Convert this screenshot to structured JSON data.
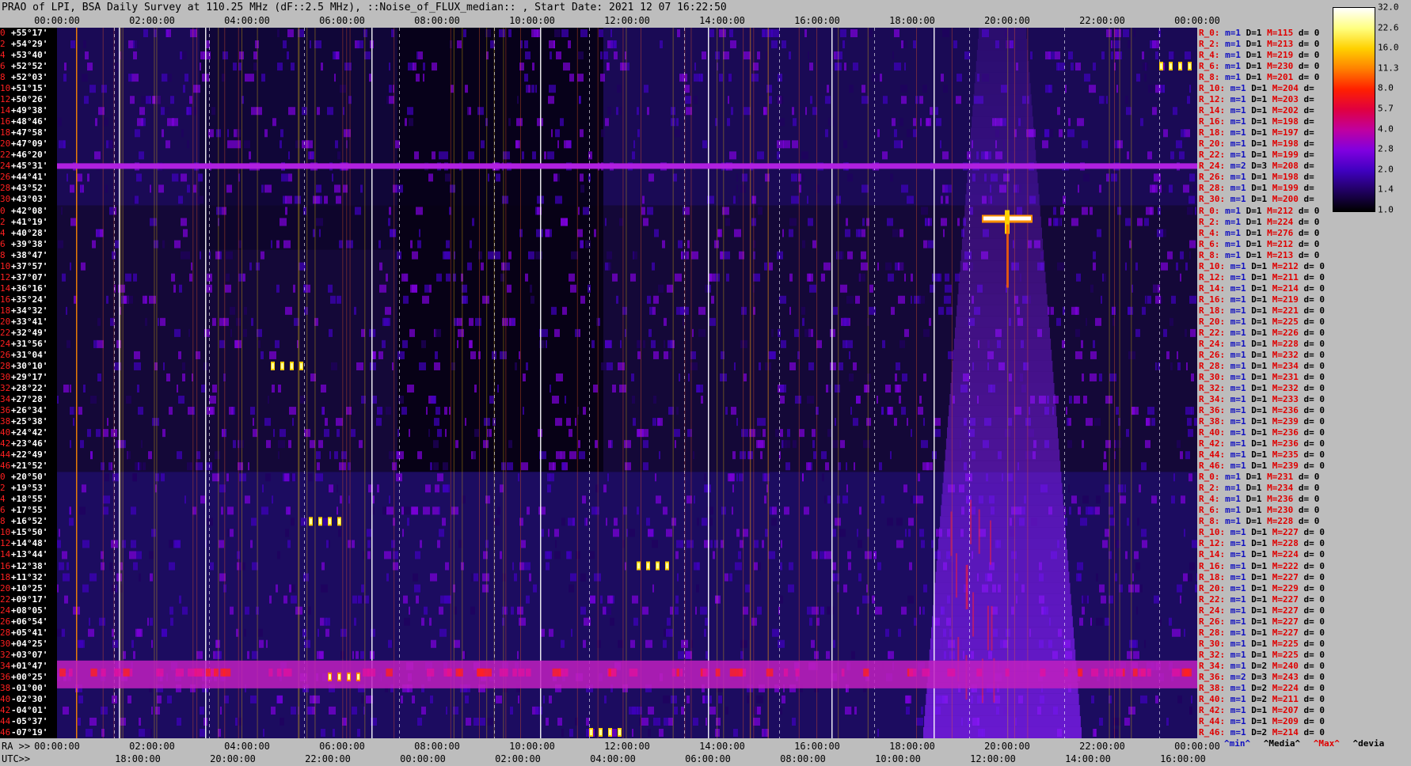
{
  "title": "PRAO of LPI, BSA Daily Survey at 110.25 MHz (dF::2.5 MHz), ::Noise_of_FLUX_median:: , Start Date: 2021 12 07 16:22:50",
  "top_axis": [
    "00:00:00",
    "02:00:00",
    "04:00:00",
    "06:00:00",
    "08:00:00",
    "10:00:00",
    "12:00:00",
    "14:00:00",
    "16:00:00",
    "18:00:00",
    "20:00:00",
    "22:00:00",
    "00:00:00"
  ],
  "ra_prefix": "RA >>",
  "ra_axis": [
    "00:00:00",
    "02:00:00",
    "04:00:00",
    "06:00:00",
    "08:00:00",
    "10:00:00",
    "12:00:00",
    "14:00:00",
    "16:00:00",
    "18:00:00",
    "20:00:00",
    "22:00:00",
    "00:00:00"
  ],
  "utc_prefix": "UTC>>",
  "utc_axis": [
    "18:00:00",
    "20:00:00",
    "22:00:00",
    "00:00:00",
    "02:00:00",
    "04:00:00",
    "06:00:00",
    "08:00:00",
    "10:00:00",
    "12:00:00",
    "14:00:00",
    "16:00:00"
  ],
  "declinations": [
    {
      "i": "0",
      "dec": "+55°17'"
    },
    {
      "i": "2",
      "dec": "+54°29'"
    },
    {
      "i": "4",
      "dec": "+53°40'"
    },
    {
      "i": "6",
      "dec": "+52°52'"
    },
    {
      "i": "8",
      "dec": "+52°03'"
    },
    {
      "i": "10",
      "dec": "+51°15'"
    },
    {
      "i": "12",
      "dec": "+50°26'"
    },
    {
      "i": "14",
      "dec": "+49°38'"
    },
    {
      "i": "16",
      "dec": "+48°46'"
    },
    {
      "i": "18",
      "dec": "+47°58'"
    },
    {
      "i": "20",
      "dec": "+47°09'"
    },
    {
      "i": "22",
      "dec": "+46°20'"
    },
    {
      "i": "24",
      "dec": "+45°31'"
    },
    {
      "i": "26",
      "dec": "+44°41'"
    },
    {
      "i": "28",
      "dec": "+43°52'"
    },
    {
      "i": "30",
      "dec": "+43°03'"
    },
    {
      "i": "0",
      "dec": "+42°08'"
    },
    {
      "i": "2",
      "dec": "+41°19'"
    },
    {
      "i": "4",
      "dec": "+40°28'"
    },
    {
      "i": "6",
      "dec": "+39°38'"
    },
    {
      "i": "8",
      "dec": "+38°47'"
    },
    {
      "i": "10",
      "dec": "+37°57'"
    },
    {
      "i": "12",
      "dec": "+37°07'"
    },
    {
      "i": "14",
      "dec": "+36°16'"
    },
    {
      "i": "16",
      "dec": "+35°24'"
    },
    {
      "i": "18",
      "dec": "+34°32'"
    },
    {
      "i": "20",
      "dec": "+33°41'"
    },
    {
      "i": "22",
      "dec": "+32°49'"
    },
    {
      "i": "24",
      "dec": "+31°56'"
    },
    {
      "i": "26",
      "dec": "+31°04'"
    },
    {
      "i": "28",
      "dec": "+30°10'"
    },
    {
      "i": "30",
      "dec": "+29°17'"
    },
    {
      "i": "32",
      "dec": "+28°22'"
    },
    {
      "i": "34",
      "dec": "+27°28'"
    },
    {
      "i": "36",
      "dec": "+26°34'"
    },
    {
      "i": "38",
      "dec": "+25°38'"
    },
    {
      "i": "40",
      "dec": "+24°42'"
    },
    {
      "i": "42",
      "dec": "+23°46'"
    },
    {
      "i": "44",
      "dec": "+22°49'"
    },
    {
      "i": "46",
      "dec": "+21°52'"
    },
    {
      "i": "0",
      "dec": "+20°50'"
    },
    {
      "i": "2",
      "dec": "+19°53'"
    },
    {
      "i": "4",
      "dec": "+18°55'"
    },
    {
      "i": "6",
      "dec": "+17°55'"
    },
    {
      "i": "8",
      "dec": "+16°52'"
    },
    {
      "i": "10",
      "dec": "+15°50'"
    },
    {
      "i": "12",
      "dec": "+14°48'"
    },
    {
      "i": "14",
      "dec": "+13°44'"
    },
    {
      "i": "16",
      "dec": "+12°38'"
    },
    {
      "i": "18",
      "dec": "+11°32'"
    },
    {
      "i": "20",
      "dec": "+10°25'"
    },
    {
      "i": "22",
      "dec": "+09°17'"
    },
    {
      "i": "24",
      "dec": "+08°05'"
    },
    {
      "i": "26",
      "dec": "+06°54'"
    },
    {
      "i": "28",
      "dec": "+05°41'"
    },
    {
      "i": "30",
      "dec": "+04°25'"
    },
    {
      "i": "32",
      "dec": "+03°07'"
    },
    {
      "i": "34",
      "dec": "+01°47'"
    },
    {
      "i": "36",
      "dec": "+00°25'"
    },
    {
      "i": "38",
      "dec": "-01°00'"
    },
    {
      "i": "40",
      "dec": "-02°30'"
    },
    {
      "i": "42",
      "dec": "-04°01'"
    },
    {
      "i": "44",
      "dec": "-05°37'"
    },
    {
      "i": "46",
      "dec": "-07°19'"
    }
  ],
  "stats": [
    {
      "r": "R_0:",
      "m": "m=1",
      "D": "D=1",
      "M": "M=115",
      "d": "d= 0"
    },
    {
      "r": "R_2:",
      "m": "m=1",
      "D": "D=1",
      "M": "M=213",
      "d": "d= 0"
    },
    {
      "r": "R_4:",
      "m": "m=1",
      "D": "D=1",
      "M": "M=219",
      "d": "d= 0"
    },
    {
      "r": "R_6:",
      "m": "m=1",
      "D": "D=1",
      "M": "M=230",
      "d": "d= 0"
    },
    {
      "r": "R_8:",
      "m": "m=1",
      "D": "D=1",
      "M": "M=201",
      "d": "d= 0"
    },
    {
      "r": "R_10:",
      "m": "m=1",
      "D": "D=1",
      "M": "M=204",
      "d": "d="
    },
    {
      "r": "R_12:",
      "m": "m=1",
      "D": "D=1",
      "M": "M=203",
      "d": "d="
    },
    {
      "r": "R_14:",
      "m": "m=1",
      "D": "D=1",
      "M": "M=202",
      "d": "d="
    },
    {
      "r": "R_16:",
      "m": "m=1",
      "D": "D=1",
      "M": "M=198",
      "d": "d="
    },
    {
      "r": "R_18:",
      "m": "m=1",
      "D": "D=1",
      "M": "M=197",
      "d": "d="
    },
    {
      "r": "R_20:",
      "m": "m=1",
      "D": "D=1",
      "M": "M=198",
      "d": "d="
    },
    {
      "r": "R_22:",
      "m": "m=1",
      "D": "D=1",
      "M": "M=199",
      "d": "d="
    },
    {
      "r": "R_24:",
      "m": "m=2",
      "D": "D=3",
      "M": "M=208",
      "d": "d="
    },
    {
      "r": "R_26:",
      "m": "m=1",
      "D": "D=1",
      "M": "M=198",
      "d": "d="
    },
    {
      "r": "R_28:",
      "m": "m=1",
      "D": "D=1",
      "M": "M=199",
      "d": "d="
    },
    {
      "r": "R_30:",
      "m": "m=1",
      "D": "D=1",
      "M": "M=200",
      "d": "d="
    },
    {
      "r": "R_0:",
      "m": "m=1",
      "D": "D=1",
      "M": "M=212",
      "d": "d= 0"
    },
    {
      "r": "R_2:",
      "m": "m=1",
      "D": "D=1",
      "M": "M=224",
      "d": "d= 0"
    },
    {
      "r": "R_4:",
      "m": "m=1",
      "D": "D=1",
      "M": "M=276",
      "d": "d= 0"
    },
    {
      "r": "R_6:",
      "m": "m=1",
      "D": "D=1",
      "M": "M=212",
      "d": "d= 0"
    },
    {
      "r": "R_8:",
      "m": "m=1",
      "D": "D=1",
      "M": "M=213",
      "d": "d= 0"
    },
    {
      "r": "R_10:",
      "m": "m=1",
      "D": "D=1",
      "M": "M=212",
      "d": "d= 0"
    },
    {
      "r": "R_12:",
      "m": "m=1",
      "D": "D=1",
      "M": "M=211",
      "d": "d= 0"
    },
    {
      "r": "R_14:",
      "m": "m=1",
      "D": "D=1",
      "M": "M=214",
      "d": "d= 0"
    },
    {
      "r": "R_16:",
      "m": "m=1",
      "D": "D=1",
      "M": "M=219",
      "d": "d= 0"
    },
    {
      "r": "R_18:",
      "m": "m=1",
      "D": "D=1",
      "M": "M=221",
      "d": "d= 0"
    },
    {
      "r": "R_20:",
      "m": "m=1",
      "D": "D=1",
      "M": "M=225",
      "d": "d= 0"
    },
    {
      "r": "R_22:",
      "m": "m=1",
      "D": "D=1",
      "M": "M=226",
      "d": "d= 0"
    },
    {
      "r": "R_24:",
      "m": "m=1",
      "D": "D=1",
      "M": "M=228",
      "d": "d= 0"
    },
    {
      "r": "R_26:",
      "m": "m=1",
      "D": "D=1",
      "M": "M=232",
      "d": "d= 0"
    },
    {
      "r": "R_28:",
      "m": "m=1",
      "D": "D=1",
      "M": "M=234",
      "d": "d= 0"
    },
    {
      "r": "R_30:",
      "m": "m=1",
      "D": "D=1",
      "M": "M=231",
      "d": "d= 0"
    },
    {
      "r": "R_32:",
      "m": "m=1",
      "D": "D=1",
      "M": "M=232",
      "d": "d= 0"
    },
    {
      "r": "R_34:",
      "m": "m=1",
      "D": "D=1",
      "M": "M=233",
      "d": "d= 0"
    },
    {
      "r": "R_36:",
      "m": "m=1",
      "D": "D=1",
      "M": "M=236",
      "d": "d= 0"
    },
    {
      "r": "R_38:",
      "m": "m=1",
      "D": "D=1",
      "M": "M=239",
      "d": "d= 0"
    },
    {
      "r": "R_40:",
      "m": "m=1",
      "D": "D=1",
      "M": "M=236",
      "d": "d= 0"
    },
    {
      "r": "R_42:",
      "m": "m=1",
      "D": "D=1",
      "M": "M=236",
      "d": "d= 0"
    },
    {
      "r": "R_44:",
      "m": "m=1",
      "D": "D=1",
      "M": "M=235",
      "d": "d= 0"
    },
    {
      "r": "R_46:",
      "m": "m=1",
      "D": "D=1",
      "M": "M=239",
      "d": "d= 0"
    },
    {
      "r": "R_0:",
      "m": "m=1",
      "D": "D=1",
      "M": "M=231",
      "d": "d= 0"
    },
    {
      "r": "R_2:",
      "m": "m=1",
      "D": "D=1",
      "M": "M=234",
      "d": "d= 0"
    },
    {
      "r": "R_4:",
      "m": "m=1",
      "D": "D=1",
      "M": "M=236",
      "d": "d= 0"
    },
    {
      "r": "R_6:",
      "m": "m=1",
      "D": "D=1",
      "M": "M=230",
      "d": "d= 0"
    },
    {
      "r": "R_8:",
      "m": "m=1",
      "D": "D=1",
      "M": "M=228",
      "d": "d= 0"
    },
    {
      "r": "R_10:",
      "m": "m=1",
      "D": "D=1",
      "M": "M=227",
      "d": "d= 0"
    },
    {
      "r": "R_12:",
      "m": "m=1",
      "D": "D=1",
      "M": "M=228",
      "d": "d= 0"
    },
    {
      "r": "R_14:",
      "m": "m=1",
      "D": "D=1",
      "M": "M=224",
      "d": "d= 0"
    },
    {
      "r": "R_16:",
      "m": "m=1",
      "D": "D=1",
      "M": "M=222",
      "d": "d= 0"
    },
    {
      "r": "R_18:",
      "m": "m=1",
      "D": "D=1",
      "M": "M=227",
      "d": "d= 0"
    },
    {
      "r": "R_20:",
      "m": "m=1",
      "D": "D=1",
      "M": "M=229",
      "d": "d= 0"
    },
    {
      "r": "R_22:",
      "m": "m=1",
      "D": "D=1",
      "M": "M=227",
      "d": "d= 0"
    },
    {
      "r": "R_24:",
      "m": "m=1",
      "D": "D=1",
      "M": "M=227",
      "d": "d= 0"
    },
    {
      "r": "R_26:",
      "m": "m=1",
      "D": "D=1",
      "M": "M=227",
      "d": "d= 0"
    },
    {
      "r": "R_28:",
      "m": "m=1",
      "D": "D=1",
      "M": "M=227",
      "d": "d= 0"
    },
    {
      "r": "R_30:",
      "m": "m=1",
      "D": "D=1",
      "M": "M=225",
      "d": "d= 0"
    },
    {
      "r": "R_32:",
      "m": "m=1",
      "D": "D=1",
      "M": "M=225",
      "d": "d= 0"
    },
    {
      "r": "R_34:",
      "m": "m=1",
      "D": "D=2",
      "M": "M=240",
      "d": "d= 0"
    },
    {
      "r": "R_36:",
      "m": "m=2",
      "D": "D=3",
      "M": "M=243",
      "d": "d= 0"
    },
    {
      "r": "R_38:",
      "m": "m=1",
      "D": "D=2",
      "M": "M=224",
      "d": "d= 0"
    },
    {
      "r": "R_40:",
      "m": "m=1",
      "D": "D=2",
      "M": "M=211",
      "d": "d= 0"
    },
    {
      "r": "R_42:",
      "m": "m=1",
      "D": "D=1",
      "M": "M=207",
      "d": "d= 0"
    },
    {
      "r": "R_44:",
      "m": "m=1",
      "D": "D=1",
      "M": "M=209",
      "d": "d= 0"
    },
    {
      "r": "R_46:",
      "m": "m=1",
      "D": "D=2",
      "M": "M=214",
      "d": "d= 0"
    }
  ],
  "colorbar": {
    "labels": [
      "32.0",
      "22.6",
      "16.0",
      "11.3",
      "8.0",
      "5.7",
      "4.0",
      "2.8",
      "2.0",
      "1.4",
      "1.0"
    ],
    "colors": [
      "#ffffff",
      "#ffff80",
      "#ffd000",
      "#ff8000",
      "#ff2000",
      "#e00040",
      "#c000a0",
      "#8000e0",
      "#4000c0",
      "#200060",
      "#000000"
    ]
  },
  "legend": {
    "min": "^min^",
    "median": "^Media^",
    "max": "^Max^",
    "devia": "^devia"
  },
  "chart_data": {
    "type": "heatmap",
    "title": "PRAO of LPI, BSA Daily Survey at 110.25 MHz (dF::2.5 MHz), ::Noise_of_FLUX_median:: , Start Date: 2021 12 07 16:22:50",
    "xlabel": "RA / UTC",
    "ylabel": "",
    "x_range": [
      "00:00:00",
      "00:00:00"
    ],
    "rows": 64,
    "colorbar_range": [
      1.0,
      32.0
    ],
    "colorbar_scale": "log2",
    "features": [
      {
        "kind": "hband",
        "row": 12,
        "value": 4.0
      },
      {
        "kind": "hband",
        "row": 58,
        "value": 5.7
      },
      {
        "kind": "hotspot",
        "ra_h": 20.0,
        "row": 17,
        "value": 32.0
      },
      {
        "kind": "hotspot",
        "ra_h": 5.6,
        "row": 44,
        "value": 16.0
      },
      {
        "kind": "hotspot",
        "ra_h": 4.8,
        "row": 30,
        "value": 16.0
      },
      {
        "kind": "hotspot",
        "ra_h": 12.5,
        "row": 48,
        "value": 16.0
      },
      {
        "kind": "hotspot",
        "ra_h": 6.0,
        "row": 58,
        "value": 11.3
      },
      {
        "kind": "hotspot",
        "ra_h": 23.5,
        "row": 3,
        "value": 16.0
      },
      {
        "kind": "hotspot",
        "ra_h": 11.5,
        "row": 63,
        "value": 16.0
      },
      {
        "kind": "plume",
        "ra_h_from": 18.8,
        "ra_h_to": 21.0,
        "row_from": 40,
        "row_to": 63,
        "value": 4.0
      }
    ]
  }
}
